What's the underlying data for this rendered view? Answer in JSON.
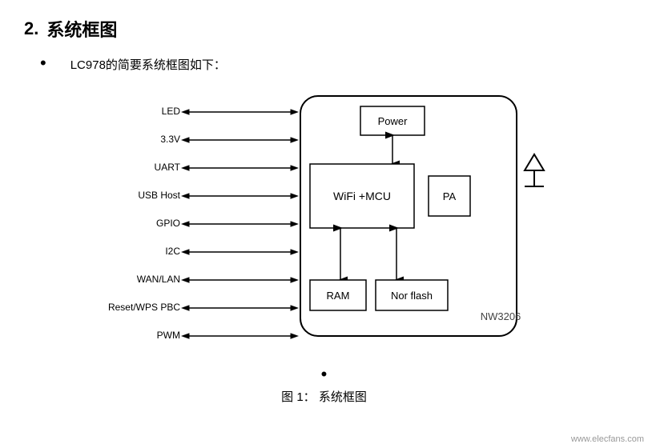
{
  "section": {
    "number": "2.",
    "title": "系统框图"
  },
  "bullet_text": "LC978的简要系统框图如下：",
  "signals": [
    "LED",
    "3.3V",
    "UART",
    "USB Host",
    "GPIO",
    "I2C",
    "WAN/LAN",
    "Reset/WPS PBC",
    "PWM"
  ],
  "chip": {
    "power_label": "Power",
    "wifi_label": "WiFi +MCU",
    "pa_label": "PA",
    "ram_label": "RAM",
    "norflash_label": "Nor flash",
    "chip_id": "NW3206"
  },
  "caption": "图 1：  系统框图",
  "watermark": "www.elecfans.com"
}
